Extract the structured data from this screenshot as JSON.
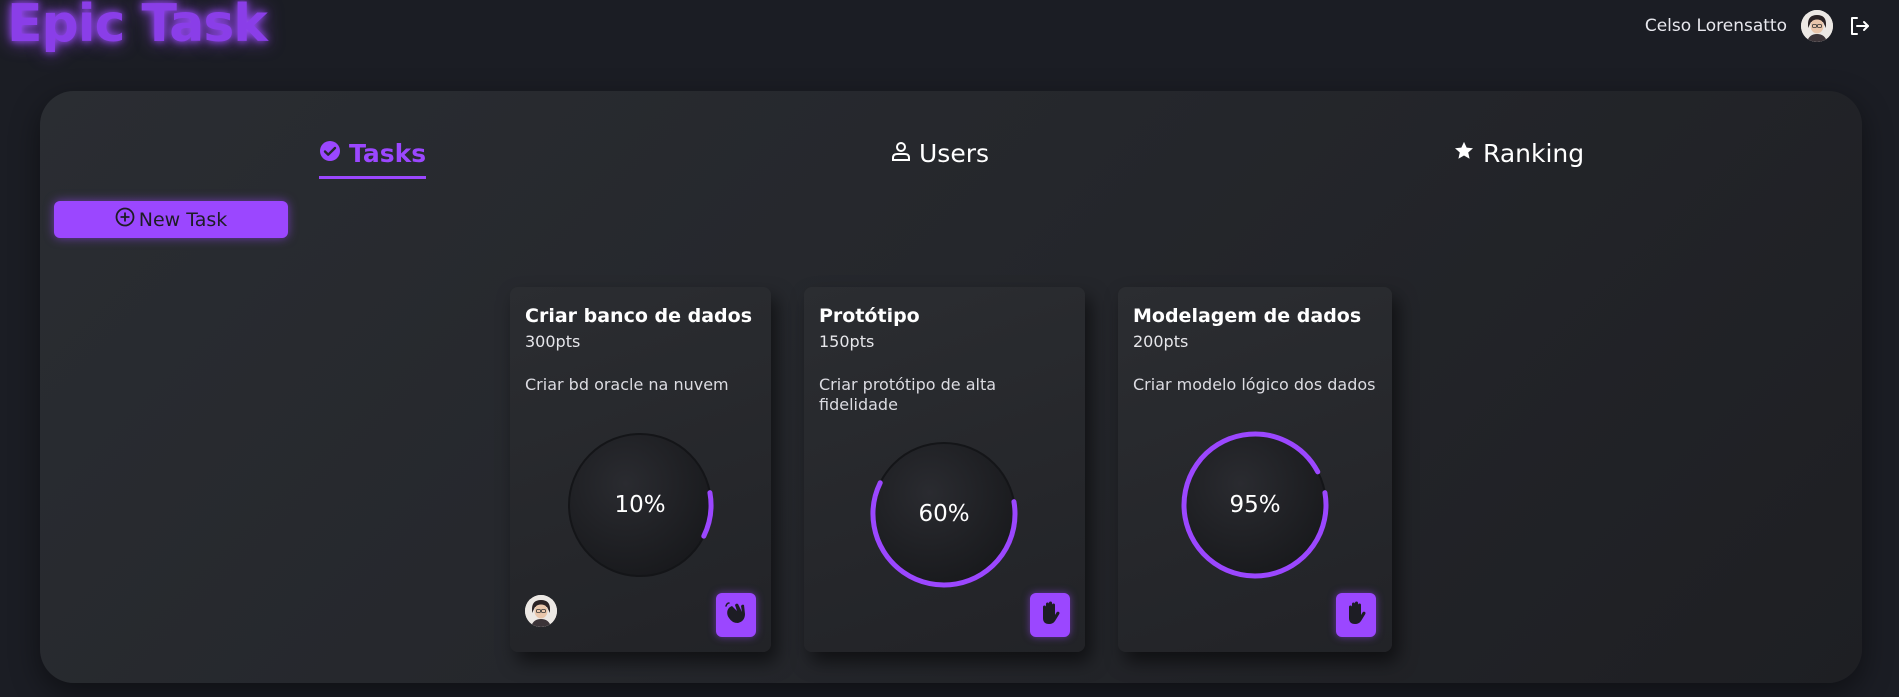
{
  "header": {
    "brand": "Epic Task",
    "user_name": "Celso Lorensatto"
  },
  "tabs": [
    {
      "label": "Tasks",
      "icon": "check-circle-icon",
      "active": true
    },
    {
      "label": "Users",
      "icon": "user-icon",
      "active": false
    },
    {
      "label": "Ranking",
      "icon": "star-icon",
      "active": false
    }
  ],
  "new_task_label": "New Task",
  "tasks": [
    {
      "title": "Criar banco de dados",
      "points": "300pts",
      "description": "Criar bd oracle na nuvem",
      "progress": 0.1,
      "progress_label": "10%",
      "assignee_avatar": true,
      "action_icon": "waving-hand-icon"
    },
    {
      "title": "Protótipo",
      "points": "150pts",
      "description": "Criar protótipo de alta fidelidade",
      "progress": 0.6,
      "progress_label": "60%",
      "assignee_avatar": false,
      "action_icon": "raised-hand-icon"
    },
    {
      "title": "Modelagem de dados",
      "points": "200pts",
      "description": "Criar modelo lógico dos dados",
      "progress": 0.95,
      "progress_label": "95%",
      "assignee_avatar": false,
      "action_icon": "raised-hand-icon"
    }
  ],
  "colors": {
    "accent": "#9b47ff",
    "background": "#1b1d24",
    "panel": "#26282d"
  }
}
